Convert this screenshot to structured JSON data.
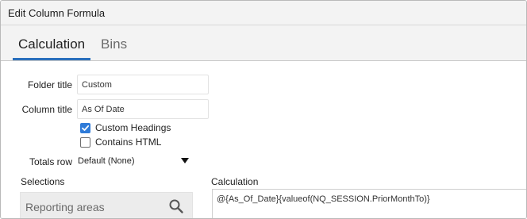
{
  "dialog": {
    "title": "Edit Column Formula"
  },
  "tabs": [
    {
      "label": "Calculation",
      "active": true
    },
    {
      "label": "Bins",
      "active": false
    }
  ],
  "form": {
    "folder_title": {
      "label": "Folder title",
      "value": "Custom"
    },
    "column_title": {
      "label": "Column title",
      "value": "As Of Date"
    },
    "custom_headings": {
      "label": "Custom Headings",
      "checked": true
    },
    "contains_html": {
      "label": "Contains HTML",
      "checked": false
    },
    "totals_row": {
      "label": "Totals row",
      "value": "Default (None)"
    }
  },
  "selections": {
    "label": "Selections",
    "reporting_areas": "Reporting areas"
  },
  "calculation": {
    "label": "Calculation",
    "formula": "@{As_Of_Date}{valueof(NQ_SESSION.PriorMonthTo)}"
  },
  "colors": {
    "accent": "#2a6fbd",
    "checkbox_checked": "#2f7bd8",
    "header_bg": "#f3f3f3"
  },
  "icons": {
    "checkmark": "check-icon",
    "dropdown": "caret-down-icon",
    "search": "search-icon"
  }
}
